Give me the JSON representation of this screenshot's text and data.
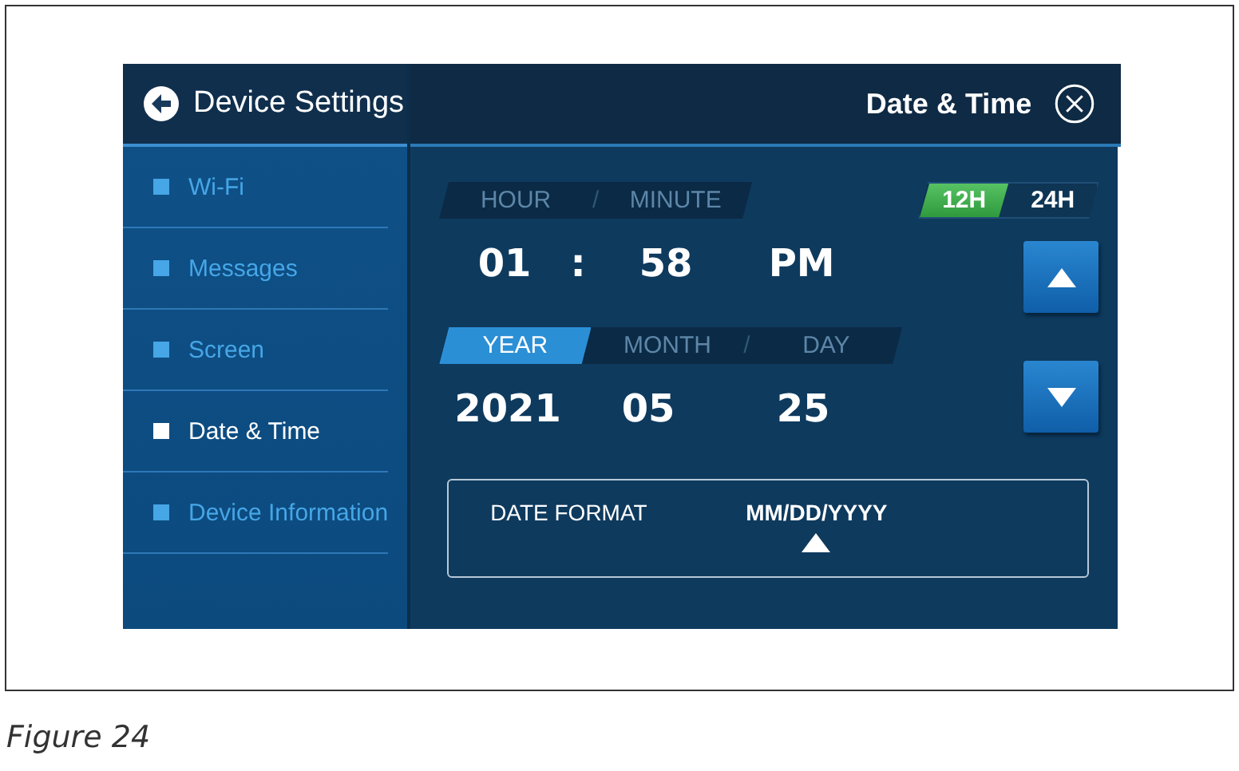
{
  "sidebar": {
    "title": "Device Settings",
    "items": [
      {
        "label": "Wi-Fi",
        "selected": false
      },
      {
        "label": "Messages",
        "selected": false
      },
      {
        "label": "Screen",
        "selected": false
      },
      {
        "label": "Date & Time",
        "selected": true
      },
      {
        "label": "Device Information",
        "selected": false
      }
    ]
  },
  "panel": {
    "title": "Date & Time",
    "time_tabs": [
      {
        "label": "HOUR",
        "selected": false
      },
      {
        "label": "MINUTE",
        "selected": false,
        "separator": "/"
      }
    ],
    "clock_modes": [
      {
        "label": "12H",
        "selected": true
      },
      {
        "label": "24H",
        "selected": false
      }
    ],
    "time": {
      "hour": "01",
      "colon": ":",
      "minute": "58",
      "period": "PM"
    },
    "date_tabs": [
      {
        "label": "YEAR",
        "selected": true
      },
      {
        "label": "MONTH",
        "selected": false
      },
      {
        "label": "DAY",
        "selected": false,
        "separator": "/"
      }
    ],
    "date": {
      "year": "2021",
      "month": "05",
      "day": "25"
    },
    "date_format": {
      "label": "DATE FORMAT",
      "value": "MM/DD/YYYY"
    }
  },
  "caption": "Figure 24"
}
